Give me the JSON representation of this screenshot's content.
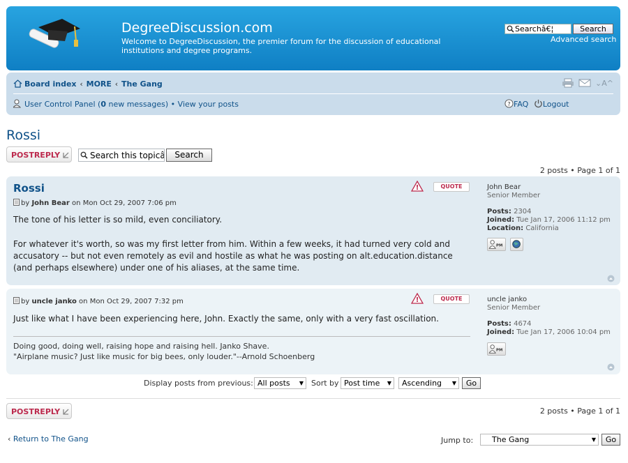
{
  "header": {
    "site_title": "DegreeDiscussion.com",
    "site_desc": "Welcome to DegreeDiscussion, the premier forum for the discussion of educational institutions and degree programs.",
    "search_value": "Searchâ€¦",
    "search_button": "Search",
    "advanced_search": "Advanced search"
  },
  "navbar": {
    "crumbs": [
      "Board index",
      "MORE",
      "The Gang"
    ],
    "crumb_sep": "‹",
    "ucp_label": "User Control Panel",
    "new_messages_count": "0",
    "new_messages_label": "new messages",
    "view_posts": "View your posts",
    "faq": "FAQ",
    "logout": "Logout",
    "font_toggle": "A"
  },
  "topic": {
    "title": "Rossi",
    "post_reply": "POSTREPLY",
    "search_placeholder": "Search this topicâ€¦",
    "search_button": "Search",
    "page_info": "2 posts • Page 1 of 1"
  },
  "posts": [
    {
      "subject": "Rossi",
      "by": "by",
      "author": "John Bear",
      "on": "on",
      "date": "Mon Oct 29, 2007 7:06 pm",
      "paragraphs": [
        "The tone of his letter is so mild, even conciliatory.",
        "For whatever it's worth, so was my first letter from him. Within a few weeks, it had turned very cold and accusatory -- but not even remotely as evil and hostile as what he was posting on alt.education.distance (and perhaps elsewhere) under one of his aliases, at the same time."
      ],
      "quote_label": "QUOTE",
      "profile": {
        "name": "John Bear",
        "rank": "Senior Member",
        "posts_label": "Posts:",
        "posts": "2304",
        "joined_label": "Joined:",
        "joined": "Tue Jan 17, 2006 11:12 pm",
        "location_label": "Location:",
        "location": "California"
      }
    },
    {
      "subject": "",
      "by": "by",
      "author": "uncle janko",
      "on": "on",
      "date": "Mon Oct 29, 2007 7:32 pm",
      "paragraphs": [
        "Just like what I have been experiencing here, John. Exactly the same, only with a very fast oscillation."
      ],
      "signature": [
        "Doing good, doing well, raising hope and raising hell. Janko Shave.",
        "\"Airplane music? Just like music for big bees, only louder.\"--Arnold Schoenberg"
      ],
      "quote_label": "QUOTE",
      "profile": {
        "name": "uncle janko",
        "rank": "Senior Member",
        "posts_label": "Posts:",
        "posts": "4674",
        "joined_label": "Joined:",
        "joined": "Tue Jan 17, 2006 10:04 pm"
      }
    }
  ],
  "sort": {
    "display_label": "Display posts from previous:",
    "display_value": "All posts",
    "sort_by_label": "Sort by",
    "sort_by_value": "Post time",
    "order_value": "Ascending",
    "go": "Go"
  },
  "footer": {
    "post_reply": "POSTREPLY",
    "page_info": "2 posts • Page 1 of 1",
    "return_arrow": "‹",
    "return_label": "Return to The Gang",
    "jump_label": "Jump to:",
    "jump_value": "The Gang",
    "go": "Go"
  },
  "colors": {
    "header_blue": "#1a92d4",
    "link": "#105289",
    "reply_red": "#bc2a4d",
    "post_bg1": "#ecf3f7",
    "post_bg2": "#e1ebf2",
    "navbar": "#cadceb"
  }
}
